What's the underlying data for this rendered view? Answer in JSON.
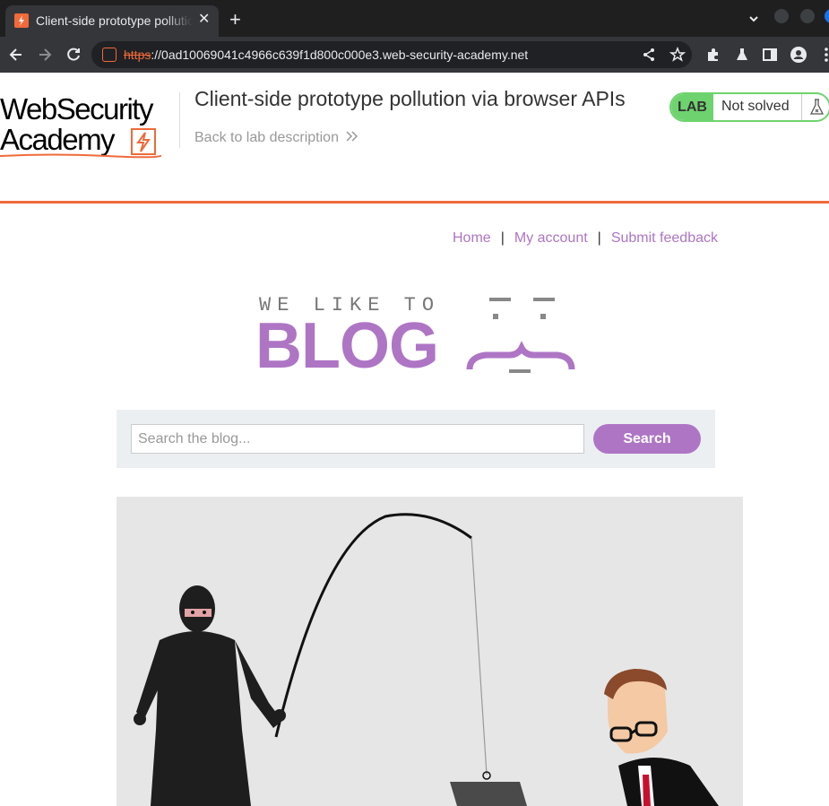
{
  "browser": {
    "tab_title": "Client-side prototype pollution via browser APIs",
    "tab_close": "✕",
    "new_tab": "+",
    "url_scheme": "https",
    "url_rest": "://0ad10069041c4966c639f1d800c000e3.web-security-academy.net"
  },
  "lab": {
    "logo_line1": "WebSecurity",
    "logo_line2": "Academy",
    "title": "Client-side prototype pollution via browser APIs",
    "back_link": "Back to lab description",
    "badge": "LAB",
    "status": "Not solved"
  },
  "nav": {
    "home": "Home",
    "separator": "|",
    "my_account": "My account",
    "submit_feedback": "Submit feedback"
  },
  "blog_logo": {
    "tagline": "WE LIKE TO",
    "word": "BLOG"
  },
  "search": {
    "placeholder": "Search the blog...",
    "button_label": "Search"
  },
  "colors": {
    "accent_orange": "#f06a3a",
    "blog_purple": "#ae75c5",
    "lab_green": "#6ed36e",
    "search_panel_bg": "#ebeff2"
  }
}
